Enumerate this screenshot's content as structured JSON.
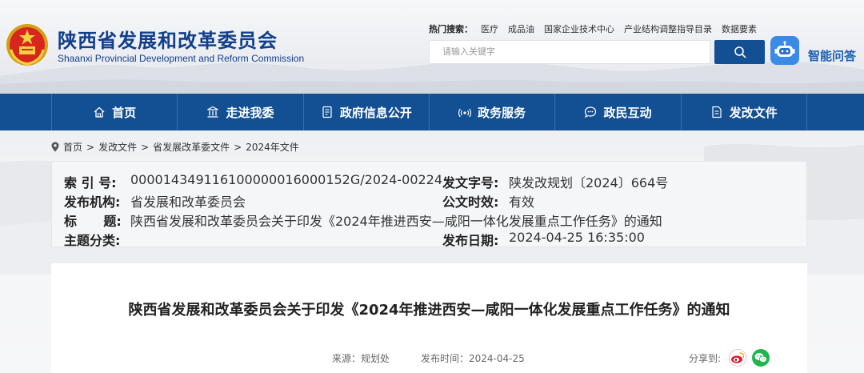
{
  "header": {
    "title": "陕西省发展和改革委员会",
    "subtitle": "Shaanxi Provincial Development and Reform Commission",
    "hot_search_label": "热门搜索：",
    "hot_keywords": [
      "医疗",
      "成品油",
      "国家企业技术中心",
      "产业结构调整指导目录",
      "数据要素"
    ],
    "search_placeholder": "请输入关键字",
    "smart_qa_label": "智能问答"
  },
  "nav": {
    "items": [
      {
        "label": "首页",
        "icon": "home-icon"
      },
      {
        "label": "走进我委",
        "icon": "building-icon"
      },
      {
        "label": "政府信息公开",
        "icon": "document-icon"
      },
      {
        "label": "政务服务",
        "icon": "broadcast-icon"
      },
      {
        "label": "政民互动",
        "icon": "chat-icon"
      },
      {
        "label": "发改文件",
        "icon": "file-icon"
      }
    ]
  },
  "breadcrumb": {
    "items": [
      "首页",
      "发改文件",
      "省发展改革委文件",
      "2024年文件"
    ],
    "separator": ">"
  },
  "meta": {
    "index_label": "索 引 号:",
    "index_value": "000014349116100000016000152G/2024-00224",
    "doc_no_label": "发文字号:",
    "doc_no_value": "陕发改规划〔2024〕664号",
    "issuer_label": "发布机构:",
    "issuer_value": "省发展和改革委员会",
    "validity_label": "公文时效:",
    "validity_value": "有效",
    "title_label": "标      题:",
    "title_value": "陕西省发展和改革委员会关于印发《2024年推进西安—咸阳一体化发展重点工作任务》的通知",
    "topic_label": "主题分类:",
    "topic_value": "",
    "date_label": "发布日期:",
    "date_value": "2024-04-25 16:35:00"
  },
  "article": {
    "title": "陕西省发展和改革委员会关于印发《2024年推进西安—咸阳一体化发展重点工作任务》的通知",
    "source": "来源：规划处",
    "publish_time": "发布时间：2024-04-25",
    "share_label": "分享到:"
  },
  "colors": {
    "nav_bg": "#124f93",
    "title_blue": "#123f8c",
    "qa_blue": "#1b5fb3",
    "weibo": "#e6162d",
    "wechat": "#20b54c"
  }
}
